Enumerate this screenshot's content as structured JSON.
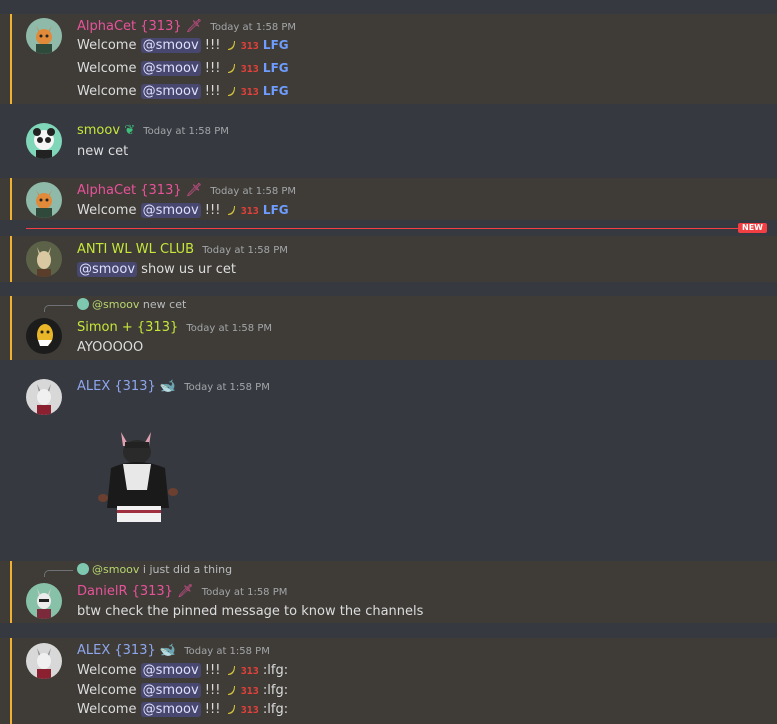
{
  "colors": {
    "alpha": "#e8529a",
    "smoov": "#c6e63a",
    "anti": "#c6e63a",
    "simon": "#c6e63a",
    "alex": "#8ea6ee",
    "daniel": "#e8529a",
    "highlight_bar": "#f0b132",
    "new_divider": "#f23f43"
  },
  "emoji": {
    "e313": "313",
    "elfg": "LFG"
  },
  "messages": [
    {
      "author": "AlphaCet {313}",
      "time": "Today at 1:58 PM",
      "lines": [
        {
          "pre": "Welcome ",
          "mention": "@smoov",
          "post": " !!!"
        },
        {
          "pre": "Welcome ",
          "mention": "@smoov",
          "post": " !!!"
        },
        {
          "pre": "Welcome ",
          "mention": "@smoov",
          "post": " !!!"
        }
      ]
    },
    {
      "author": "smoov",
      "time": "Today at 1:58 PM",
      "text": "new cet"
    },
    {
      "author": "AlphaCet {313}",
      "time": "Today at 1:58 PM",
      "lines": [
        {
          "pre": "Welcome ",
          "mention": "@smoov",
          "post": " !!!"
        }
      ]
    },
    {
      "new_label": "NEW"
    },
    {
      "author": "ANTI WL WL CLUB",
      "time": "Today at 1:58 PM",
      "mention": "@smoov",
      "post": " show us ur cet"
    },
    {
      "reply_to": "@smoov",
      "reply_text": "new cet",
      "author": "Simon + {313}",
      "time": "Today at 1:58 PM",
      "text": "AYOOOOO"
    },
    {
      "author": "ALEX {313}",
      "time": "Today at 1:58 PM"
    },
    {
      "reply_to": "@smoov",
      "reply_text": "i just did a thing",
      "author": "DanielR {313}",
      "time": "Today at 1:58 PM",
      "text": "btw check the pinned message to know the channels"
    },
    {
      "author": "ALEX {313}",
      "time": "Today at 1:58 PM",
      "lines": [
        {
          "pre": "Welcome ",
          "mention": "@smoov",
          "post": " !!!",
          "tail": ":lfg:"
        },
        {
          "pre": "Welcome ",
          "mention": "@smoov",
          "post": " !!!",
          "tail": ":lfg:"
        },
        {
          "pre": "Welcome ",
          "mention": "@smoov",
          "post": " !!!",
          "tail": ":lfg:"
        }
      ]
    }
  ]
}
